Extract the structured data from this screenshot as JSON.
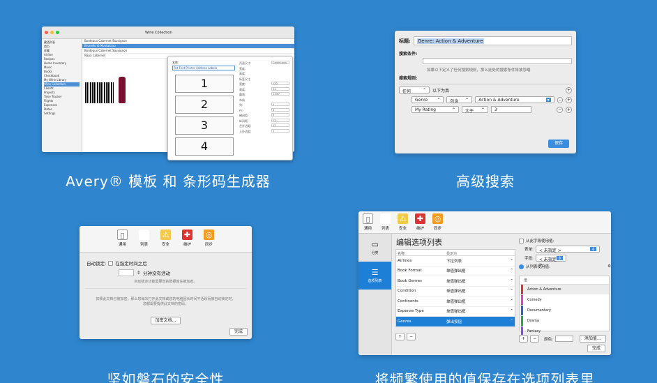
{
  "captions": {
    "avery": "Avery® 模板 和 条形码生成器",
    "search": "高级搜索",
    "security": "坚如磐石的安全性",
    "picklist": "将频繁使用的值保存在选项列表里"
  },
  "avery_panel": {
    "window_title": "Wine Collection",
    "sidebar": [
      "藏酒列表",
      "首页",
      "库藏",
      "Airline",
      "Recipes",
      "Home Inventory",
      "Music",
      "Books",
      "Checkbook",
      "My Wine Library",
      "Wine Collection",
      "Clients",
      "Projects",
      "Time Tracker",
      "Flights",
      "Expenses",
      "Dates",
      "Settings"
    ],
    "rows": [
      "Bordeaux Cabernet Sauvignon",
      "Brunello di Montalcino",
      "Bordeaux Cabernet Sauvignon",
      "Napa Cabernet"
    ],
    "label_sheet_title": "名称:",
    "label_name": "Pet Feet Printer Address Labels",
    "labels": [
      "1",
      "2",
      "3",
      "4"
    ],
    "options": [
      {
        "k": "页面尺寸:",
        "v": "Continuous"
      },
      {
        "k": "宽度:",
        "v": ""
      },
      {
        "k": "高度:",
        "v": ""
      },
      {
        "k": "标签尺寸",
        "v": ""
      },
      {
        "k": "宽度:",
        "v": "120"
      },
      {
        "k": "高度:",
        "v": "54"
      },
      {
        "k": "圆角:",
        "v": "1.667"
      },
      {
        "k": "布局",
        "v": ""
      },
      {
        "k": "列:",
        "v": "1"
      },
      {
        "k": "行:",
        "v": "4"
      },
      {
        "k": "横间距:",
        "v": "0"
      },
      {
        "k": "纵间距:",
        "v": "2.2"
      },
      {
        "k": "左外边距:",
        "v": "12"
      },
      {
        "k": "上外边距:",
        "v": "1"
      }
    ]
  },
  "search_panel": {
    "title_label": "标题:",
    "title_value": "Genre: Action & Adventure",
    "cond_label": "搜索条件:",
    "note": "如果以下定义了任何搜索规则，那么此处的搜索条件将被忽略",
    "rules_label": "搜索规则:",
    "match": "任何",
    "match_suffix": "以下为真",
    "rule1": {
      "field": "Genre",
      "op": "包含",
      "value": "Action & Adventure"
    },
    "rule2": {
      "field": "My Rating",
      "op": "大于",
      "value": "3"
    },
    "save": "保存"
  },
  "security_panel": {
    "toolbar": [
      "通用",
      "列表",
      "安全",
      "维护",
      "同步"
    ],
    "autolock_label": "自动锁定:",
    "autolock_check": "在指定时间之后",
    "minutes_label": "分钟没有活动",
    "hint": "自动锁定功能需要您的数据库先被加密。",
    "note": "如果此文档已被加密，那么您每次打开此文档或您的电脑因长时间不活跃而被自动锁定时，您都需要提供此文档的密码。",
    "encrypt_button": "加密文档...",
    "done": "完成"
  },
  "picklist_panel": {
    "toolbar": [
      "通用",
      "列表",
      "安全",
      "维护",
      "同步"
    ],
    "side": [
      "分类",
      "选项列表"
    ],
    "heading": "编辑选项列表",
    "col_name": "名称",
    "col_display": "显示为",
    "items": [
      {
        "name": "Airlines",
        "display": "下拉列表"
      },
      {
        "name": "Book Format",
        "display": "单值弹出框"
      },
      {
        "name": "Book Genres",
        "display": "单值弹出框"
      },
      {
        "name": "Condition",
        "display": "单值弹出框"
      },
      {
        "name": "Continents",
        "display": "单值弹出框"
      },
      {
        "name": "Expense Type",
        "display": "单值弹出框"
      },
      {
        "name": "Genres",
        "display": "弹出按钮"
      }
    ],
    "from_field": "从此字段使用值:",
    "table_label": "表单:",
    "table_value": "< 未指定 >",
    "field_label": "字段:",
    "field_value": "< 未指定 >",
    "from_list": "从列表使用值:",
    "value_header": "值",
    "values": [
      {
        "text": "Action & Adventure",
        "color": "#d33"
      },
      {
        "text": "Comedy",
        "color": "#e040d0"
      },
      {
        "text": "Documentary",
        "color": "#2a5fd6"
      },
      {
        "text": "Drama",
        "color": "#2aa84a"
      },
      {
        "text": "Fantasy",
        "color": "#8a4fd6"
      }
    ],
    "color_label": "颜色:",
    "add_value": "添加值...",
    "done": "完成"
  }
}
